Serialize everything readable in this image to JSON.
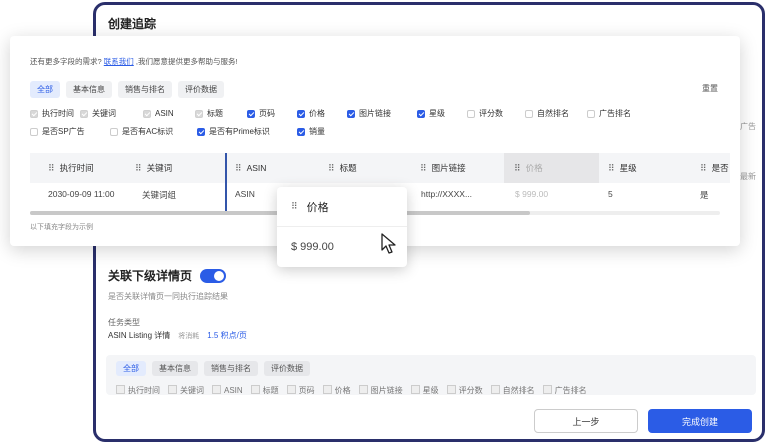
{
  "dialog": {
    "title": "创建追踪",
    "side_text_1": "广告",
    "side_text_2": "最新",
    "toggle_label": "关联下级详情页",
    "toggle_desc": "是否关联详情页一同执行追踪结果",
    "task_type_label": "任务类型",
    "task_type_value": "ASIN Listing 详情",
    "task_consume": "将消耗",
    "task_credit": "1.5 积点/页",
    "tabs": [
      "全部",
      "基本信息",
      "销售与排名",
      "评价数据"
    ],
    "fields": [
      "执行时间",
      "关键词",
      "ASIN",
      "标题",
      "页码",
      "价格",
      "图片链接",
      "星级",
      "评分数",
      "自然排名",
      "广告排名"
    ],
    "prev_button": "上一步",
    "done_button": "完成创建"
  },
  "popup": {
    "hint_prefix": "还有更多字段的需求?",
    "hint_link": "联系我们",
    "hint_suffix": ",我们愿意提供更多帮助与服务!",
    "reset": "重置",
    "tabs": [
      "全部",
      "基本信息",
      "销售与排名",
      "评价数据"
    ],
    "checks_row1": [
      {
        "label": "执行时间",
        "state": "disabled"
      },
      {
        "label": "关键词",
        "state": "disabled"
      },
      {
        "label": "ASIN",
        "state": "disabled"
      },
      {
        "label": "标题",
        "state": "disabled"
      },
      {
        "label": "页码",
        "state": "checked"
      },
      {
        "label": "价格",
        "state": "checked"
      },
      {
        "label": "图片链接",
        "state": "checked"
      },
      {
        "label": "星级",
        "state": "checked"
      },
      {
        "label": "评分数",
        "state": "unchecked"
      },
      {
        "label": "自然排名",
        "state": "unchecked"
      },
      {
        "label": "广告排名",
        "state": "unchecked"
      }
    ],
    "checks_row2": [
      {
        "label": "是否SP广告",
        "state": "unchecked"
      },
      {
        "label": "是否有AC标识",
        "state": "unchecked"
      },
      {
        "label": "是否有Prime标识",
        "state": "checked"
      },
      {
        "label": "销量",
        "state": "checked"
      }
    ],
    "table": {
      "headers": [
        "执行时间",
        "关键词",
        "ASIN",
        "标题",
        "图片链接",
        "价格",
        "星级",
        "是否"
      ],
      "row": [
        "2030-09-09 11:00",
        "关键词组",
        "ASIN",
        "",
        "http://XXXX...",
        "$ 999.00",
        "5",
        "是"
      ]
    },
    "note": "以下填充字段为示例"
  },
  "drag_card": {
    "header": "价格",
    "value": "$ 999.00"
  }
}
